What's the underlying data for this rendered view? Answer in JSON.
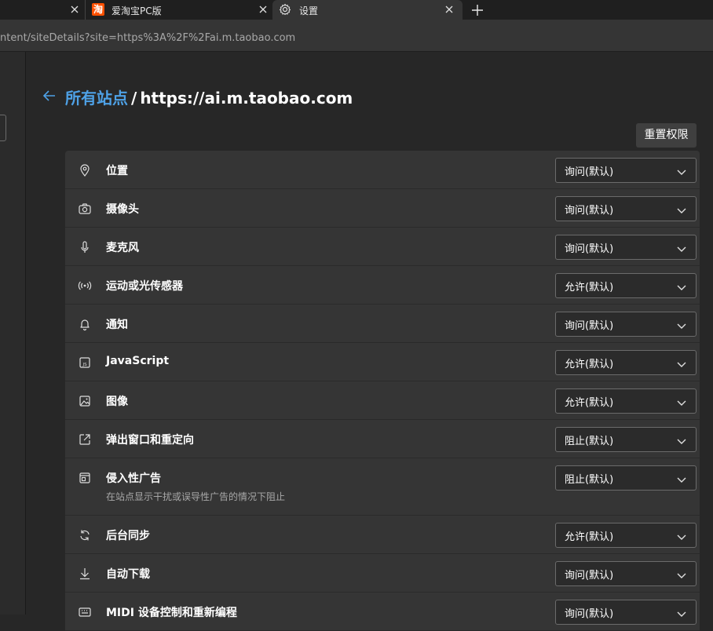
{
  "tabs": [
    {
      "title": "",
      "close": "×"
    },
    {
      "title": "爱淘宝PC版",
      "favicon": "淘",
      "close": "×"
    },
    {
      "title": "设置",
      "close": "×"
    }
  ],
  "new_tab": "+",
  "address": {
    "url": "ntent/siteDetails?site=https%3A%2F%2Fai.m.taobao.com"
  },
  "page": {
    "breadcrumb_link": "所有站点",
    "separator": "/",
    "site": "https://ai.m.taobao.com",
    "reset_label": "重置权限"
  },
  "permissions": [
    {
      "label": "位置",
      "value": "询问(默认)",
      "icon": "location-icon"
    },
    {
      "label": "摄像头",
      "value": "询问(默认)",
      "icon": "camera-icon"
    },
    {
      "label": "麦克风",
      "value": "询问(默认)",
      "icon": "microphone-icon"
    },
    {
      "label": "运动或光传感器",
      "value": "允许(默认)",
      "icon": "sensor-icon"
    },
    {
      "label": "通知",
      "value": "询问(默认)",
      "icon": "bell-icon"
    },
    {
      "label": "JavaScript",
      "value": "允许(默认)",
      "icon": "javascript-icon"
    },
    {
      "label": "图像",
      "value": "允许(默认)",
      "icon": "image-icon"
    },
    {
      "label": "弹出窗口和重定向",
      "value": "阻止(默认)",
      "icon": "popup-icon"
    },
    {
      "label": "侵入性广告",
      "sublabel": "在站点显示干扰或误导性广告的情况下阻止",
      "value": "阻止(默认)",
      "icon": "ads-icon"
    },
    {
      "label": "后台同步",
      "value": "允许(默认)",
      "icon": "sync-icon"
    },
    {
      "label": "自动下载",
      "value": "询问(默认)",
      "icon": "download-icon"
    },
    {
      "label": "MIDI 设备控制和重新编程",
      "value": "询问(默认)",
      "icon": "midi-icon"
    }
  ]
}
